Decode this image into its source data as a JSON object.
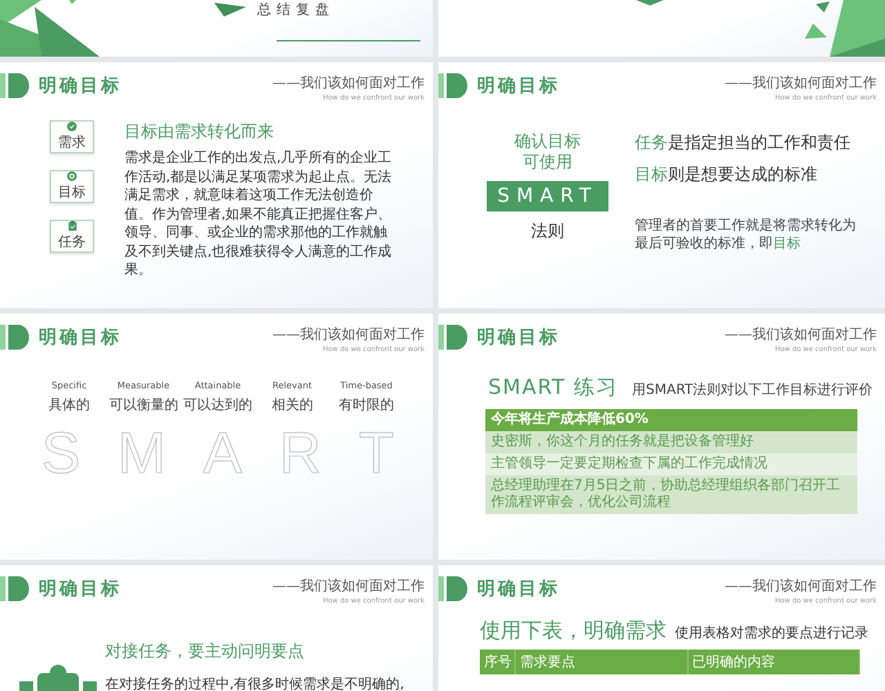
{
  "slides": [
    {
      "kind": "closing",
      "title": "总结复盘"
    },
    {
      "kind": "shapes"
    },
    {
      "kind": "needs",
      "header": {
        "title": "明确目标",
        "tagline": "——我们该如何面对工作",
        "subtitle": "How do we confront our work"
      },
      "icons": [
        "需求",
        "目标",
        "任务"
      ],
      "heading": "目标由需求转化而来",
      "paragraph": "需求是企业工作的出发点,几乎所有的企业工作活动,都是以满足某项需求为起止点。无法满足需求，就意味着这项工作无法创造价值。作为管理者,如果不能真正把握住客户、领导、同事、或企业的需求那他的工作就触及不到关键点,也很难获得令人满意的工作成果。"
    },
    {
      "kind": "smart-intro",
      "header": {
        "title": "明确目标",
        "tagline": "——我们该如何面对工作",
        "subtitle": "How do we confront our work"
      },
      "lead": [
        "确认目标",
        "可使用"
      ],
      "badge": "SMART",
      "rule": "法则",
      "statements": [
        "**任务**是指定担当的工作和责任",
        "**目标**则是想要达成的标准"
      ],
      "note": "管理者的首要工作就是将需求转化为最后可验收的标准，即**目标**"
    },
    {
      "kind": "smart-terms",
      "header": {
        "title": "明确目标",
        "tagline": "——我们该如何面对工作",
        "subtitle": "How do we confront our work"
      },
      "terms": [
        {
          "en": "Specific",
          "zh": "具体的"
        },
        {
          "en": "Measurable",
          "zh": "可以衡量的"
        },
        {
          "en": "Attainable",
          "zh": "可以达到的"
        },
        {
          "en": "Relevant",
          "zh": "相关的"
        },
        {
          "en": "Time-based",
          "zh": "有时限的"
        }
      ],
      "letters": [
        "S",
        "M",
        "A",
        "R",
        "T"
      ]
    },
    {
      "kind": "exercise",
      "header": {
        "title": "明确目标",
        "tagline": "——我们该如何面对工作",
        "subtitle": "How do we confront our work"
      },
      "heading": "SMART 练习",
      "subheading": "用SMART法则对以下工作目标进行评价",
      "rows": [
        "今年将生产成本降低60%",
        "史密斯，你这个月的任务就是把设备管理好",
        "主管领导一定要定期检查下属的工作完成情况",
        "总经理助理在7月5日之前，协助总经理组织各部门召开工作流程评审会，优化公司流程"
      ]
    },
    {
      "kind": "task",
      "header": {
        "title": "明确目标",
        "tagline": "——我们该如何面对工作",
        "subtitle": "How do we confront our work"
      },
      "heading": "对接任务，要主动问明要点",
      "paragraph": "在对接任务的过程中,有很多时候需求是不明确的,"
    },
    {
      "kind": "table",
      "header": {
        "title": "明确目标",
        "tagline": "——我们该如何面对工作",
        "subtitle": "How do we confront our work"
      },
      "heading": "使用下表，明确需求",
      "subheading": "使用表格对需求的要点进行记录",
      "columns": [
        "序号",
        "需求要点",
        "已明确的内容"
      ]
    }
  ]
}
